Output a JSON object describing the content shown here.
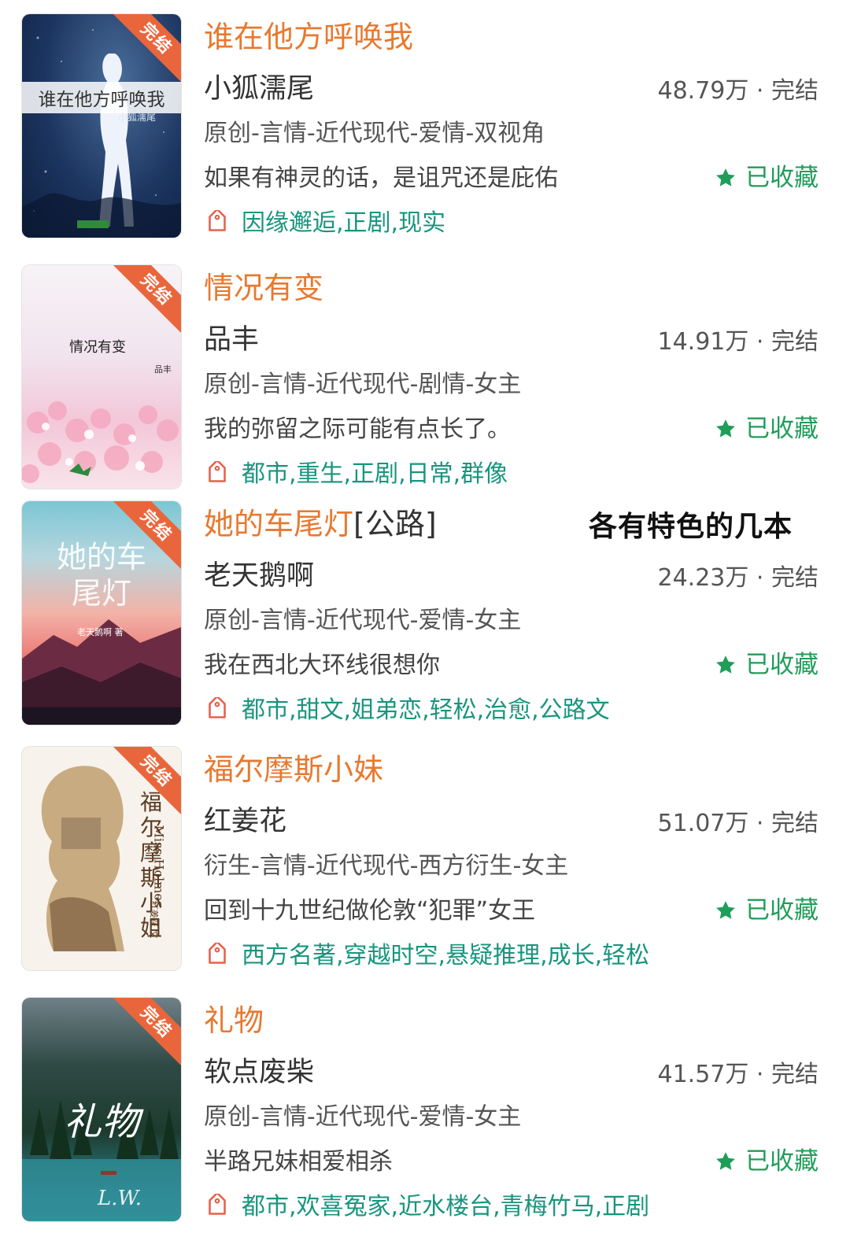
{
  "overlay_caption": "各有特色的几本",
  "books": [
    {
      "title": "谁在他方呼唤我",
      "title_suffix": "",
      "author": "小狐濡尾",
      "stats": "48.79万 · 完结",
      "category": "原创-言情-近代现代-爱情-双视角",
      "intro": "如果有神灵的话，是诅咒还是庇佑",
      "favorite_label": "已收藏",
      "tags": "因缘邂逅,正剧,现实",
      "badge": "完结",
      "cover_title": "谁在他方呼唤我",
      "cover_author": "小狐濡尾",
      "cover_icon": "silhouette-woman-icon"
    },
    {
      "title": "情况有变",
      "title_suffix": "",
      "author": "品丰",
      "stats": "14.91万 · 完结",
      "category": "原创-言情-近代现代-剧情-女主",
      "intro": "我的弥留之际可能有点长了。",
      "favorite_label": "已收藏",
      "tags": "都市,重生,正剧,日常,群像",
      "badge": "完结",
      "cover_title": "情况有变",
      "cover_author": "品丰",
      "cover_icon": "cherry-blossom-icon"
    },
    {
      "title": "她的车尾灯",
      "title_suffix": "[公路]",
      "author": "老天鹅啊",
      "stats": "24.23万 · 完结",
      "category": "原创-言情-近代现代-爱情-女主",
      "intro": "我在西北大环线很想你",
      "favorite_label": "已收藏",
      "tags": "都市,甜文,姐弟恋,轻松,治愈,公路文",
      "badge": "完结",
      "cover_title": "她的车尾灯",
      "cover_author": "老天鹅啊 著",
      "cover_icon": "mountain-icon"
    },
    {
      "title": "福尔摩斯小妹",
      "title_suffix": "",
      "author": "红姜花",
      "stats": "51.07万 · 完结",
      "category": "衍生-言情-近代现代-西方衍生-女主",
      "intro": "回到十九世纪做伦敦“犯罪”女王",
      "favorite_label": "已收藏",
      "tags": "西方名著,穿越时空,悬疑推理,成长,轻松",
      "badge": "完结",
      "cover_title": "福尔摩斯小姐",
      "cover_subtitle": "Miss Holmes",
      "cover_author": "红姜花 文",
      "cover_icon": "woman-profile-icon"
    },
    {
      "title": "礼物",
      "title_suffix": "",
      "author": "软点废柴",
      "stats": "41.57万 · 完结",
      "category": "原创-言情-近代现代-爱情-女主",
      "intro": "半路兄妹相爱相杀",
      "favorite_label": "已收藏",
      "tags": "都市,欢喜冤家,近水楼台,青梅竹马,正剧",
      "badge": "完结",
      "cover_title": "礼物",
      "cover_author": "L.W.",
      "cover_icon": "forest-icon"
    }
  ],
  "colors": {
    "title": "#e8792f",
    "favorite": "#1f9e5a",
    "tags": "#18957e",
    "badge": "#e9663c"
  }
}
